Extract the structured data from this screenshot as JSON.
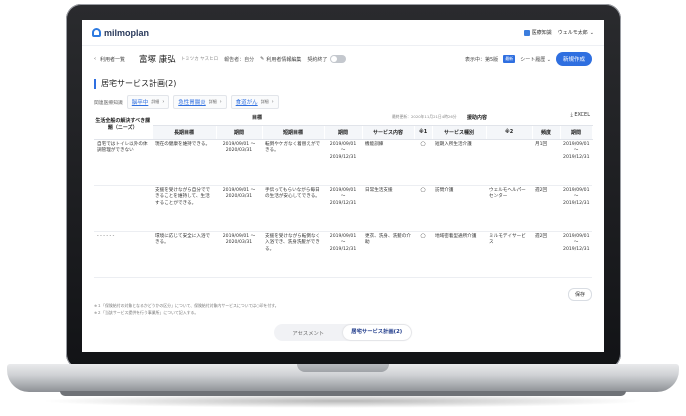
{
  "header": {
    "logo_text": "milmoplan",
    "medical_knowledge": "医療知識",
    "user_name": "ウェルモ太郎"
  },
  "toolbar": {
    "back_label": "利用者一覧",
    "patient_name": "富塚 康弘",
    "patient_kana": "トミツカ ヤスヒロ",
    "reporter": "報告者：自分",
    "edit_label": "利用者情報編集",
    "contract_label": "契約終了",
    "display_label": "表示中：第5版",
    "badge_latest": "最新",
    "sheet_switch": "シート履歴",
    "new_button": "新規作成"
  },
  "section": {
    "title": "居宅サービス計画(2)",
    "related_label": "関連医療知識",
    "tags": [
      {
        "label": "脳卒中",
        "detail": "詳細"
      },
      {
        "label": "急性胃腸炎",
        "detail": "詳細"
      },
      {
        "label": "食道がん",
        "detail": "詳細"
      }
    ]
  },
  "table": {
    "final_update": "最終更新：2020年11月21日4時26分",
    "excel_label": "EXCEL",
    "group_goal": "目標",
    "group_support": "援助内容",
    "headers": [
      "生活全般の解決すべき課題（ニーズ）",
      "長期目標",
      "期間",
      "短期目標",
      "期間",
      "サービス内容",
      "※1",
      "サービス種別",
      "※2",
      "頻度",
      "期間"
    ],
    "rows": [
      {
        "need": "自宅ではトイレ以外の体調管理ができない",
        "long_goal": "現在の健康を維持できる。",
        "long_period": "2019/09/01 ～ 2020/03/31",
        "short_goal": "転倒やケガなく着替えができる。",
        "short_period": "2019/09/01 ～ 2019/12/31",
        "service": "機能訓練",
        "mark1": "◯",
        "type": "短期入所生活介護",
        "mark2": "",
        "freq": "月1回",
        "period": "2019/09/01 ～ 2019/12/31"
      },
      {
        "need": "",
        "long_goal": "支援を受けながら自分でできることを維持して、生活することができる。",
        "long_period": "2019/09/01 ～ 2020/03/31",
        "short_goal": "手伝ってもらいながら毎日の生活が安心してできる。",
        "short_period": "2019/09/01 ～ 2019/12/31",
        "service": "日常生活支援",
        "mark1": "◯",
        "type": "訪問介護",
        "mark2": "ウェルモヘルパーセンター",
        "freq": "週2回",
        "period": "2019/09/01 ～ 2019/12/31"
      },
      {
        "need": "- - - - - -",
        "long_goal": "環境に応じて安全に入浴できる。",
        "long_period": "2019/09/01 ～ 2020/03/31",
        "short_goal": "支援を受けながら転倒なく入浴でき、洗身洗髪ができる。",
        "short_period": "2019/09/01 ～ 2019/12/31",
        "service": "更衣、洗身、洗髪の介助",
        "mark1": "◯",
        "type": "地域密着型通所介護",
        "mark2": "ミルモデイサービス",
        "freq": "週2回",
        "period": "2019/09/01 ～ 2019/12/31"
      }
    ]
  },
  "notes": [
    "※１「保険給付の対象となるかどうかの区分」について、保険給付対象内サービスについては○印を付す。",
    "※２「当該サービス提供を行う事業所」について記入する。"
  ],
  "save_label": "保存",
  "tabs": [
    {
      "label": "アセスメント",
      "active": false
    },
    {
      "label": "居宅サービス計画(2)",
      "active": true
    }
  ]
}
